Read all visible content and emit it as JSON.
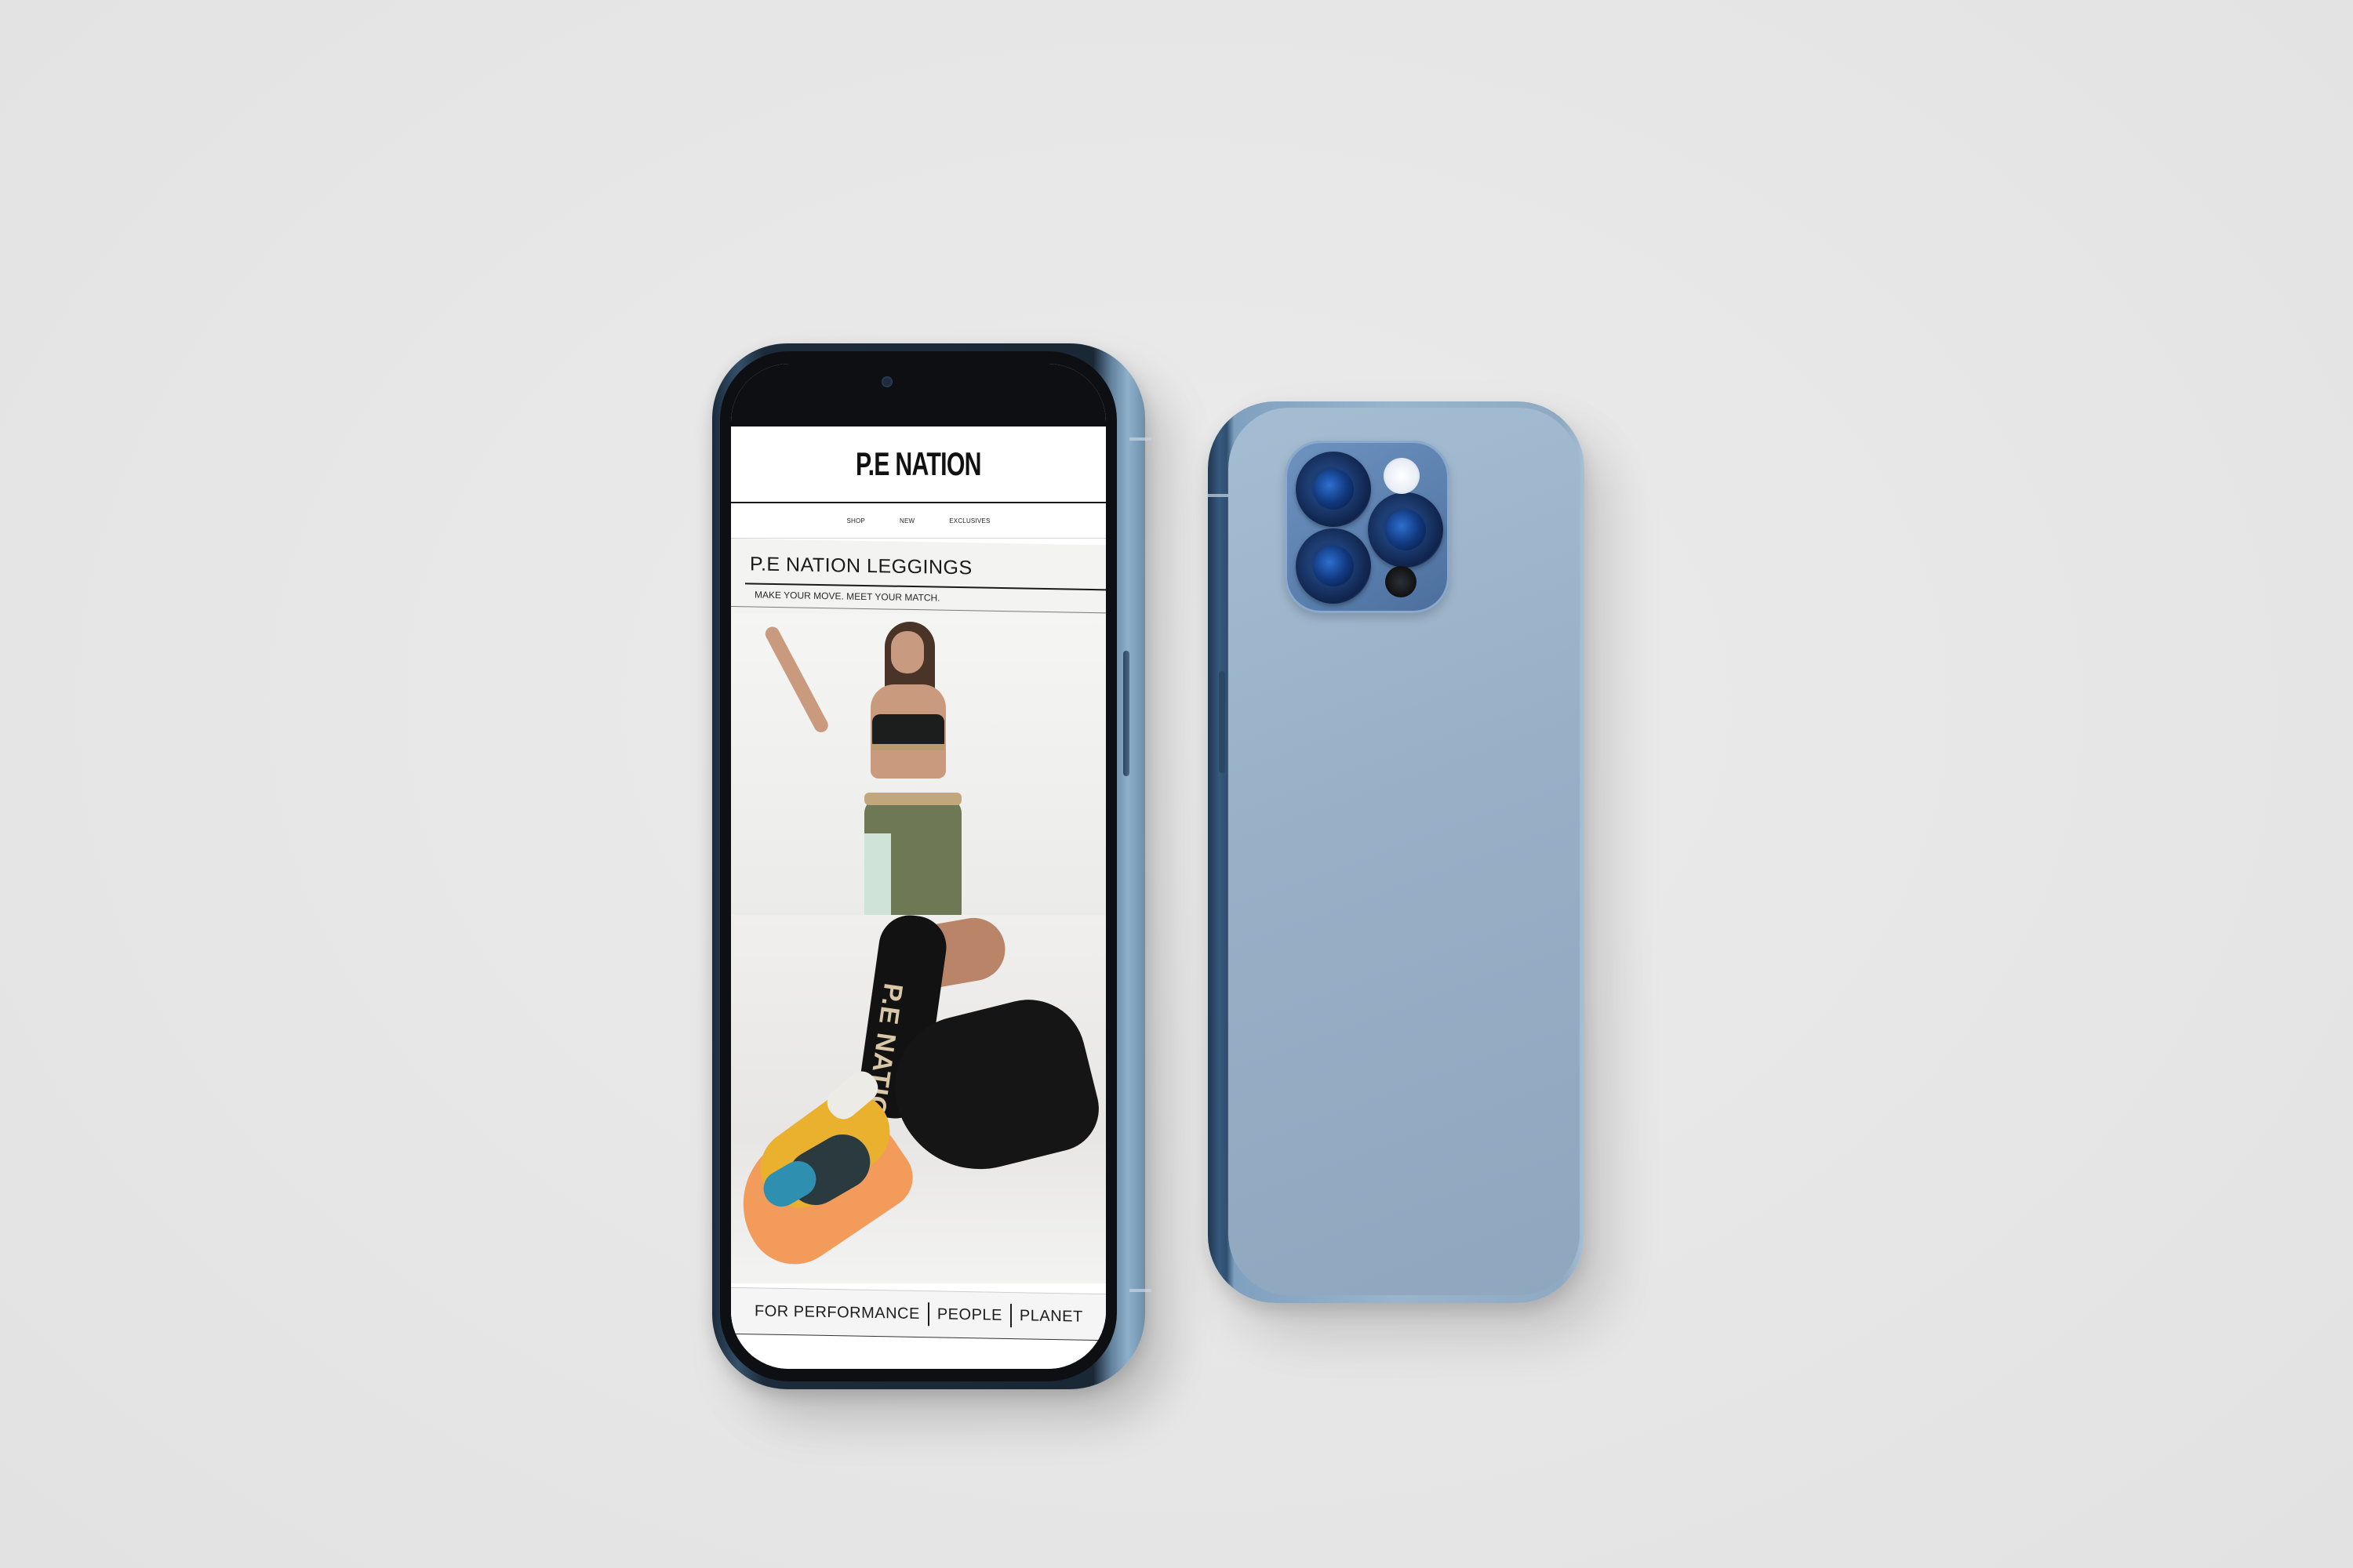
{
  "site": {
    "logo": "P.E NATION",
    "nav": [
      "SHOP",
      "NEW",
      "EXCLUSIVES"
    ],
    "hero": {
      "title": "P.E NATION LEGGINGS",
      "subtitle": "MAKE YOUR MOVE. MEET YOUR MATCH."
    },
    "legging_print": "P.E NATION",
    "tagline": [
      "FOR PERFORMANCE",
      "PEOPLE",
      "PLANET"
    ]
  },
  "colors": {
    "background": "#e8e8e8",
    "phone_blue": "#98b0c6",
    "screen_bg": "#ffffff",
    "text": "#1a1a1a"
  },
  "icons": {
    "front_camera": "camera-dot-icon",
    "rear_lenses": "camera-lens-icon",
    "flash": "flash-icon",
    "lidar": "lidar-sensor-icon"
  }
}
